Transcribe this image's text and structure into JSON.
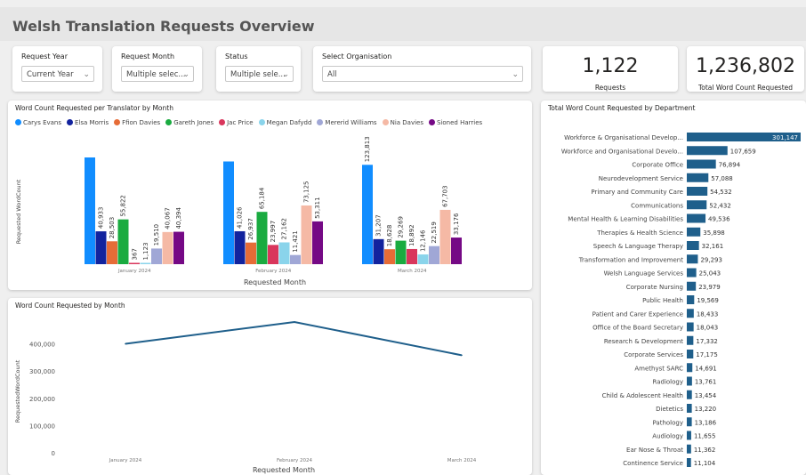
{
  "page": {
    "title": "Welsh Translation Requests Overview"
  },
  "slicers": [
    {
      "label": "Request Year",
      "value": "Current Year"
    },
    {
      "label": "Request Month",
      "value": "Multiple selec..."
    },
    {
      "label": "Status",
      "value": "Multiple sele..."
    },
    {
      "label": "Select Organisation",
      "value": "All"
    }
  ],
  "kpis": {
    "requests": {
      "value": "1,122",
      "label": "Requests"
    },
    "words": {
      "value": "1,236,802",
      "label": "Total Word Count Requested"
    }
  },
  "colors": {
    "dept_bar": "#1f5f8b",
    "line": "#1f5f8b",
    "translators": [
      "#118dff",
      "#12239e",
      "#e66c37",
      "#1aab40",
      "#d9365c",
      "#8ad4eb",
      "#a0a7d6",
      "#f5b9a5",
      "#750985"
    ]
  },
  "chart_data": [
    {
      "type": "bar",
      "title": "Word Count Requested per Translator by Month",
      "xlabel": "Requested Month",
      "ylabel": "Requested WordCount",
      "categories": [
        "January 2024",
        "February 2024",
        "March 2024"
      ],
      "series": [
        {
          "name": "Carys Evans",
          "values": [
            133000,
            128000,
            123813
          ]
        },
        {
          "name": "Elsa Morris",
          "values": [
            40933,
            41026,
            31207
          ]
        },
        {
          "name": "Ffion Davies",
          "values": [
            28503,
            26937,
            18628
          ]
        },
        {
          "name": "Gareth Jones",
          "values": [
            55822,
            65184,
            29269
          ]
        },
        {
          "name": "Jac Price",
          "values": [
            367,
            23997,
            18892
          ]
        },
        {
          "name": "Megan Dafydd",
          "values": [
            1123,
            27162,
            12146
          ]
        },
        {
          "name": "Mererid Williams",
          "values": [
            19510,
            11421,
            22519
          ]
        },
        {
          "name": "Nia Davies",
          "values": [
            40067,
            73125,
            67703
          ]
        },
        {
          "name": "Sioned Harries",
          "values": [
            40394,
            53311,
            33176
          ]
        }
      ],
      "labels": [
        [
          null,
          "40,933",
          "28,503",
          "55,822",
          "367",
          "1,123",
          "19,510",
          "40,067",
          "40,394"
        ],
        [
          null,
          "41,026",
          "26,937",
          "65,184",
          "23,997",
          "27,162",
          "11,421",
          "73,125",
          "53,311"
        ],
        [
          "123,813",
          "31,207",
          "18,628",
          "29,269",
          "18,892",
          "12,146",
          "22,519",
          "67,703",
          "33,176"
        ]
      ]
    },
    {
      "type": "line",
      "title": "Word Count Requested by Month",
      "xlabel": "Requested Month",
      "ylabel": "RequestedWordCount",
      "x": [
        "January 2024",
        "February 2024",
        "March 2024"
      ],
      "values": [
        400000,
        480000,
        358000
      ],
      "ylim": [
        0,
        480000
      ],
      "yticks": [
        "0",
        "100,000",
        "200,000",
        "300,000",
        "400,000"
      ]
    },
    {
      "type": "bar",
      "orientation": "horizontal",
      "title": "Total Word Count Requested by Department",
      "categories": [
        "Workforce & Organisational Develop...",
        "Workforce and Organisational Develo...",
        "Corporate Office",
        "Neurodevelopment Service",
        "Primary and Community Care",
        "Communications",
        "Mental Health & Learning Disabilities",
        "Therapies & Health Science",
        "Speech & Language Therapy",
        "Transformation and Improvement",
        "Welsh Language Services",
        "Corporate Nursing",
        "Public Health",
        "Patient and Carer Experience",
        "Office of the Board Secretary",
        "Research & Development",
        "Corporate Services",
        "Amethyst SARC",
        "Radiology",
        "Child & Adolescent Health",
        "Dietetics",
        "Pathology",
        "Audiology",
        "Ear Nose & Throat",
        "Continence Service"
      ],
      "values": [
        301147,
        107659,
        76894,
        57088,
        54532,
        52432,
        49536,
        35898,
        32161,
        29293,
        25043,
        23979,
        19569,
        18433,
        18043,
        17332,
        17175,
        14691,
        13761,
        13454,
        13220,
        13186,
        11655,
        11362,
        11104
      ],
      "labels": [
        "301,147",
        "107,659",
        "76,894",
        "57,088",
        "54,532",
        "52,432",
        "49,536",
        "35,898",
        "32,161",
        "29,293",
        "25,043",
        "23,979",
        "19,569",
        "18,433",
        "18,043",
        "17,332",
        "17,175",
        "14,691",
        "13,761",
        "13,454",
        "13,220",
        "13,186",
        "11,655",
        "11,362",
        "11,104"
      ]
    }
  ]
}
